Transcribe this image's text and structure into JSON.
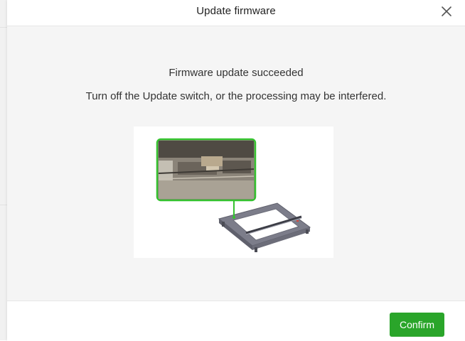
{
  "dialog": {
    "title": "Update firmware",
    "close_icon": "close-icon",
    "message": {
      "title": "Firmware update succeeded",
      "detail": "Turn off the Update switch, or the processing may be interfered."
    },
    "illustration": {
      "icon": "laser-engraver-update-switch-illustration",
      "accent_color": "#35c22f"
    },
    "confirm_label": "Confirm",
    "confirm_color": "#2aa52a"
  }
}
